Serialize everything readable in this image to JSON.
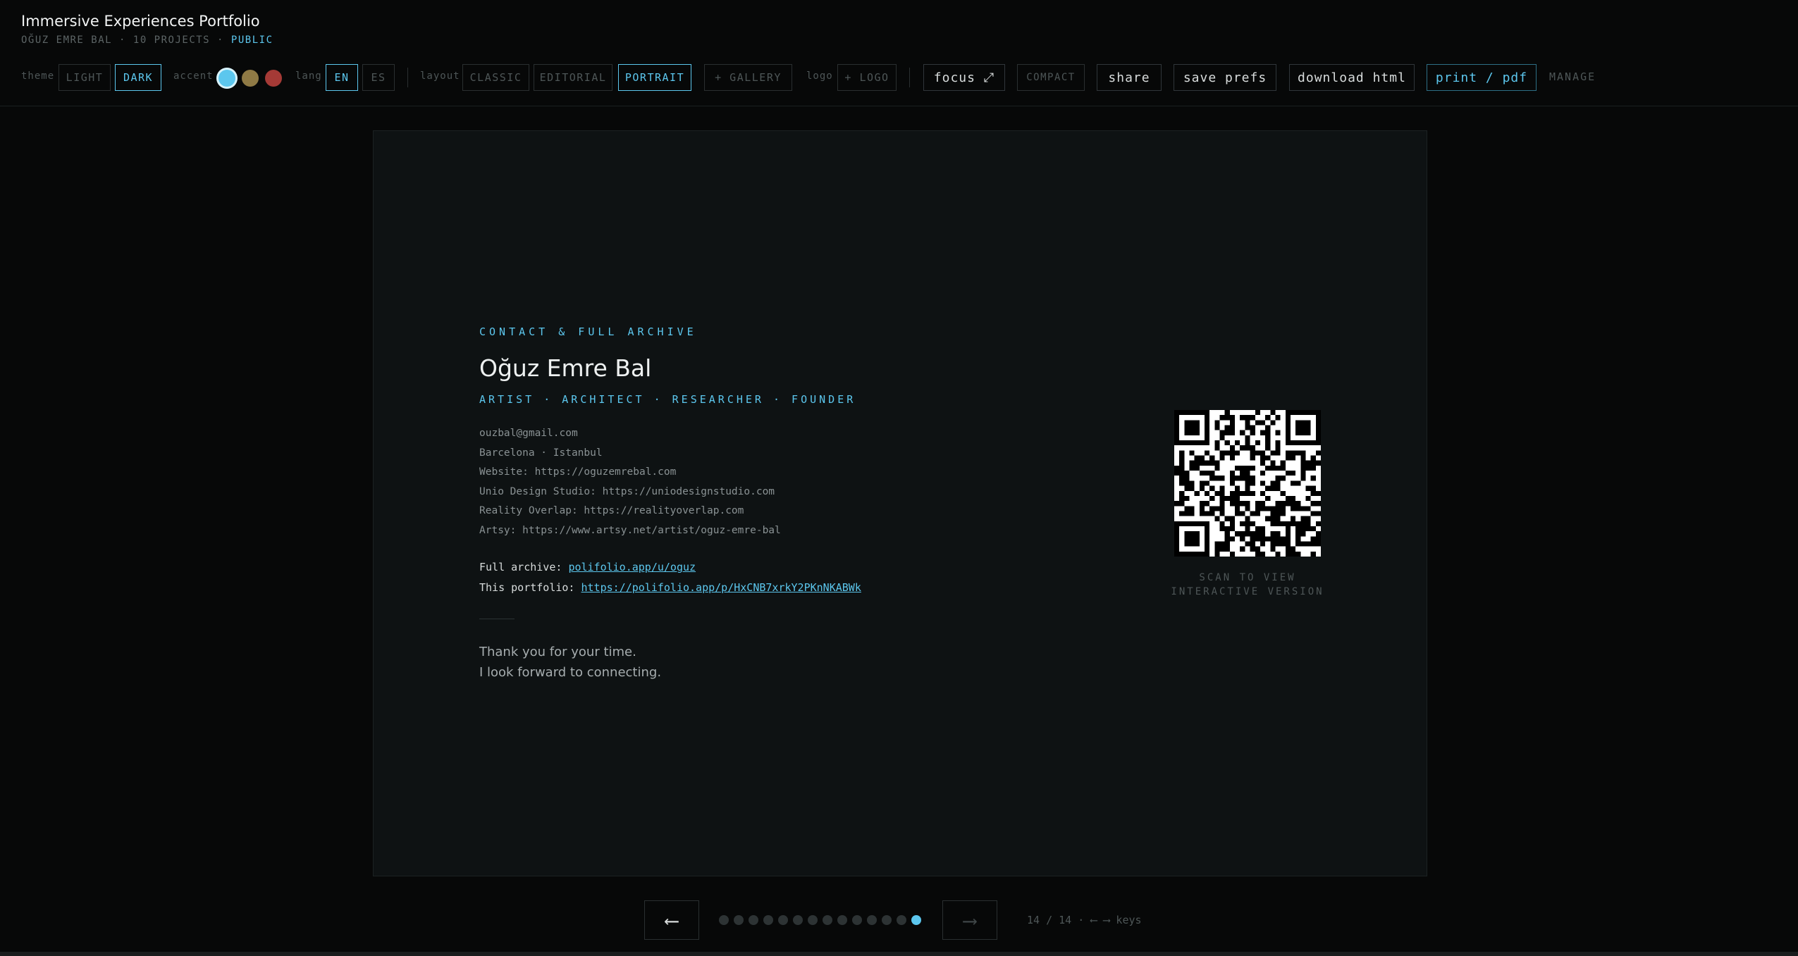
{
  "app": {
    "title": "Immersive Experiences Portfolio",
    "owner": "OĞUZ EMRE BAL",
    "projects": "10 PROJECTS",
    "separator": "·",
    "visibility": "PUBLIC"
  },
  "toolbar": {
    "theme_label": "theme",
    "theme_light": "LIGHT",
    "theme_dark": "DARK",
    "accent_label": "accent",
    "accent_colors": [
      "#5cc7ee",
      "#8f7a45",
      "#a53a36"
    ],
    "lang_label": "lang",
    "lang_en": "EN",
    "lang_es": "ES",
    "layout_label": "layout",
    "layout_classic": "CLASSIC",
    "layout_editorial": "EDITORIAL",
    "layout_portrait": "PORTRAIT",
    "gallery": "+ GALLERY",
    "logo_label": "logo",
    "logo": "+ LOGO",
    "focus": "focus ⤢",
    "compact": "COMPACT",
    "share": "share",
    "save_prefs": "save prefs",
    "download_html": "download html",
    "print_pdf": "print / pdf",
    "manage": "MANAGE"
  },
  "slide": {
    "eyebrow": "CONTACT & FULL ARCHIVE",
    "name": "Oğuz Emre Bal",
    "roles": "ARTIST · ARCHITECT · RESEARCHER · FOUNDER",
    "contact_lines": [
      "ouzbal@gmail.com",
      "Barcelona · Istanbul",
      "Website: https://oguzemrebal.com",
      "Unio Design Studio: https://uniodesignstudio.com",
      "Reality Overlap: https://realityoverlap.com",
      "Artsy: https://www.artsy.net/artist/oguz-emre-bal"
    ],
    "archive_label": "Full archive:",
    "archive_link": "polifolio.app/u/oguz",
    "portfolio_label": "This portfolio:",
    "portfolio_link": "https://polifolio.app/p/HxCNB7xrkY2PKnNKABWk",
    "thanks_1": "Thank you for your time.",
    "thanks_2": "I look forward to connecting.",
    "qr_caption_1": "SCAN TO VIEW",
    "qr_caption_2": "INTERACTIVE VERSION"
  },
  "nav": {
    "prev": "⟵",
    "next": "⟶",
    "total_pages": 14,
    "current_page": 14,
    "page_indicator": "14 / 14 · ⟵ ⟶ keys"
  },
  "colors": {
    "accent": "#5cc7ee",
    "background": "#070808",
    "slide_background": "#0e1213"
  }
}
